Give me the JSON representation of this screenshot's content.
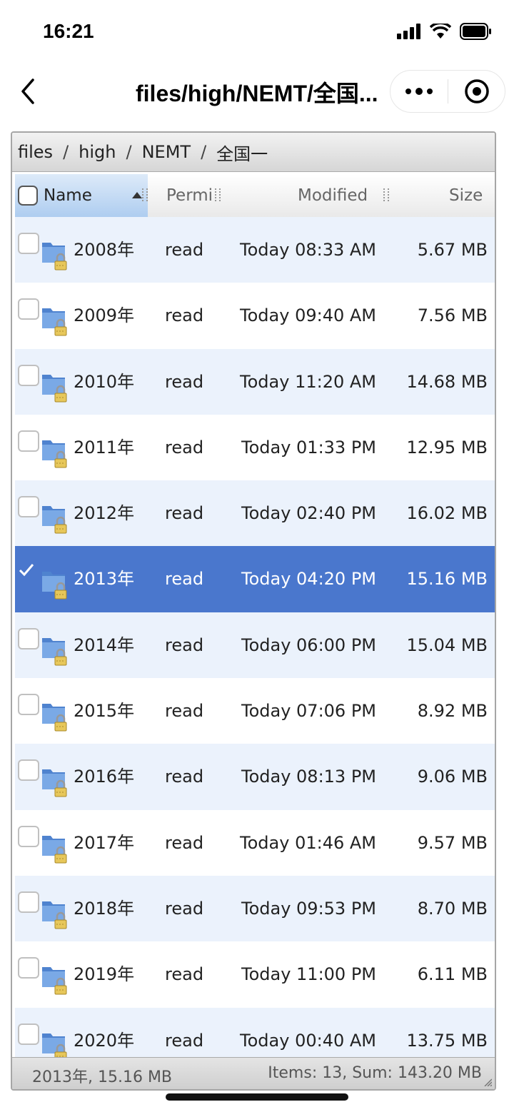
{
  "status": {
    "time": "16:21"
  },
  "nav": {
    "title": "files/high/NEMT/全国...",
    "back_icon": "chevron-left-icon",
    "more_icon": "more-dots-icon",
    "target_icon": "record-icon"
  },
  "breadcrumb": [
    "files",
    "high",
    "NEMT",
    "全国一"
  ],
  "breadcrumb_separator": "/",
  "columns": {
    "name": "Name",
    "perm": "Permi",
    "modified": "Modified",
    "size": "Size"
  },
  "rows": [
    {
      "name": "2008年",
      "perm": "read",
      "modified": "Today 08:33 AM",
      "size": "5.67 MB",
      "selected": false
    },
    {
      "name": "2009年",
      "perm": "read",
      "modified": "Today 09:40 AM",
      "size": "7.56 MB",
      "selected": false
    },
    {
      "name": "2010年",
      "perm": "read",
      "modified": "Today 11:20 AM",
      "size": "14.68 MB",
      "selected": false
    },
    {
      "name": "2011年",
      "perm": "read",
      "modified": "Today 01:33 PM",
      "size": "12.95 MB",
      "selected": false
    },
    {
      "name": "2012年",
      "perm": "read",
      "modified": "Today 02:40 PM",
      "size": "16.02 MB",
      "selected": false
    },
    {
      "name": "2013年",
      "perm": "read",
      "modified": "Today 04:20 PM",
      "size": "15.16 MB",
      "selected": true
    },
    {
      "name": "2014年",
      "perm": "read",
      "modified": "Today 06:00 PM",
      "size": "15.04 MB",
      "selected": false
    },
    {
      "name": "2015年",
      "perm": "read",
      "modified": "Today 07:06 PM",
      "size": "8.92 MB",
      "selected": false
    },
    {
      "name": "2016年",
      "perm": "read",
      "modified": "Today 08:13 PM",
      "size": "9.06 MB",
      "selected": false
    },
    {
      "name": "2017年",
      "perm": "read",
      "modified": "Today 01:46 AM",
      "size": "9.57 MB",
      "selected": false
    },
    {
      "name": "2018年",
      "perm": "read",
      "modified": "Today 09:53 PM",
      "size": "8.70 MB",
      "selected": false
    },
    {
      "name": "2019年",
      "perm": "read",
      "modified": "Today 11:00 PM",
      "size": "6.11 MB",
      "selected": false
    },
    {
      "name": "2020年",
      "perm": "read",
      "modified": "Today 00:40 AM",
      "size": "13.75 MB",
      "selected": false
    }
  ],
  "footer": {
    "selection": "2013年, 15.16 MB",
    "summary": "Items: 13, Sum: 143.20 MB"
  },
  "colors": {
    "selected_row": "#4a77cd",
    "alt_row": "#ebf2fc",
    "folder": "#5b8fd6"
  },
  "icons": {
    "folder": "locked-folder-icon",
    "check": "checkmark-icon"
  }
}
